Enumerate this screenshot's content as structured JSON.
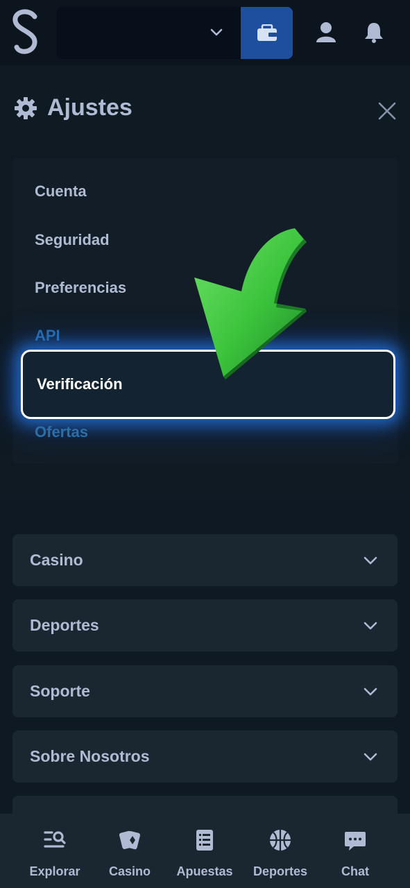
{
  "header": {
    "logo": "S",
    "balance_value": "",
    "icons": [
      "chevron-down-icon",
      "wallet-icon",
      "user-icon",
      "bell-icon"
    ],
    "wallet_color": "#1d4f9e"
  },
  "settings": {
    "title": "Ajustes",
    "items": [
      {
        "label": "Cuenta"
      },
      {
        "label": "Seguridad"
      },
      {
        "label": "Preferencias"
      },
      {
        "label": "API"
      },
      {
        "label": "Verificación",
        "highlighted": true
      },
      {
        "label": "Ofertas"
      }
    ]
  },
  "footer_sections": [
    {
      "label": "Casino"
    },
    {
      "label": "Deportes"
    },
    {
      "label": "Soporte"
    },
    {
      "label": "Sobre Nosotros"
    }
  ],
  "bottom_nav": [
    {
      "label": "Explorar",
      "icon": "explore-icon"
    },
    {
      "label": "Casino",
      "icon": "cards-icon"
    },
    {
      "label": "Apuestas",
      "icon": "betslip-icon"
    },
    {
      "label": "Deportes",
      "icon": "basketball-icon"
    },
    {
      "label": "Chat",
      "icon": "chat-icon"
    }
  ],
  "colors": {
    "background": "#0f1923",
    "panel": "#1a2630",
    "text": "#b1bad3",
    "highlight_glow": "#2678e6",
    "arrow": "#3cc43c"
  }
}
